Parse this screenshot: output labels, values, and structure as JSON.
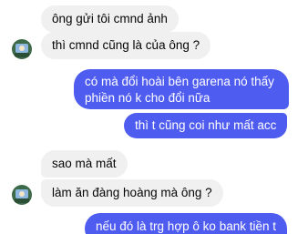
{
  "messages": [
    {
      "side": "in",
      "text": "ông gửi tôi cmnd ảnh"
    },
    {
      "side": "in",
      "text": "thì cmnd cũng là của ông ?"
    },
    {
      "side": "out",
      "lines": [
        "có mà đổi hoài bên garena nó thấy",
        "phiền nó k cho đổi nữa"
      ]
    },
    {
      "side": "out",
      "text": "thì t cũng coi như mất acc"
    },
    {
      "side": "in",
      "text": "sao mà mất"
    },
    {
      "side": "in",
      "text": "làm ăn đàng hoàng mà ông ?"
    },
    {
      "side": "out",
      "text": "nếu đó là trg hợp ô ko bank tiền t"
    }
  ],
  "colors": {
    "incoming_bubble": "#f0f0f0",
    "outgoing_bubble": "#4f5cf0",
    "avatar_bg": "#3d6b4a"
  },
  "icons": {
    "avatar": "contact-avatar-icon"
  }
}
